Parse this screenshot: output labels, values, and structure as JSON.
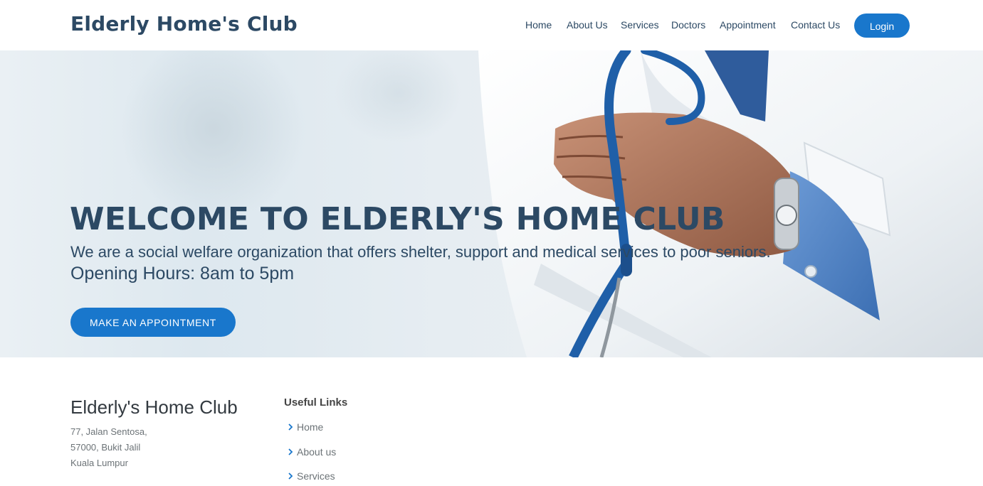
{
  "header": {
    "logo": "Elderly Home's Club",
    "nav": [
      {
        "label": "Home"
      },
      {
        "label": "About Us"
      },
      {
        "label": "Services"
      },
      {
        "label": "Doctors"
      },
      {
        "label": "Appointment"
      },
      {
        "label": "Contact Us"
      }
    ],
    "login_label": "Login"
  },
  "hero": {
    "title": "WELCOME TO ELDERLY'S HOME CLUB",
    "subtitle": "We are a social welfare organization that offers shelter, support and medical services to poor seniors.",
    "hours": "Opening Hours: 8am to 5pm",
    "cta_label": "MAKE AN APPOINTMENT"
  },
  "footer": {
    "brand": "Elderly's Home Club",
    "address": [
      "77, Jalan Sentosa,",
      "57000, Bukit Jalil",
      "Kuala Lumpur"
    ],
    "links_title": "Useful Links",
    "links": [
      {
        "label": "Home"
      },
      {
        "label": "About us"
      },
      {
        "label": "Services"
      }
    ]
  },
  "colors": {
    "primary": "#1977cc",
    "heading": "#2c4964",
    "text_muted": "#6c7377"
  },
  "icons": {
    "link_bullet": "chevron-right-icon"
  }
}
